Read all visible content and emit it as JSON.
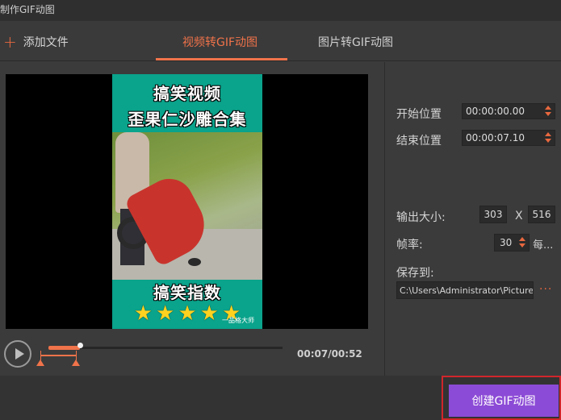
{
  "window": {
    "title": "制作GIF动图"
  },
  "toolbar": {
    "add_file_label": "添加文件"
  },
  "tabs": [
    {
      "label": "视频转GIF动图",
      "active": true
    },
    {
      "label": "图片转GIF动图",
      "active": false
    }
  ],
  "video": {
    "title_line1": "搞笑视频",
    "title_line2": "歪果仁沙雕合集",
    "bottom_caption": "搞笑指数",
    "rating_stars": 5,
    "star_glyph": "★",
    "watermark": "一品格大师"
  },
  "player": {
    "time_display": "00:07/00:52",
    "playhead_fraction": 0.135,
    "range_start_fraction": 0.0,
    "range_end_fraction": 0.135
  },
  "settings": {
    "start_label": "开始位置",
    "start_value": "00:00:00.00",
    "end_label": "结束位置",
    "end_value": "00:00:07.10",
    "size_label": "输出大小:",
    "width_value": "303",
    "times_symbol": "X",
    "height_value": "516",
    "fps_label": "帧率:",
    "fps_value": "30",
    "fps_unit": "每...",
    "save_label": "保存到:",
    "save_path": "C:\\Users\\Administrator\\Pictures",
    "more_label": "···"
  },
  "footer": {
    "create_label": "创建GIF动图"
  },
  "colors": {
    "accent": "#f0734a",
    "primary_button": "#8c4bd6",
    "highlight_border": "#d0262a"
  }
}
